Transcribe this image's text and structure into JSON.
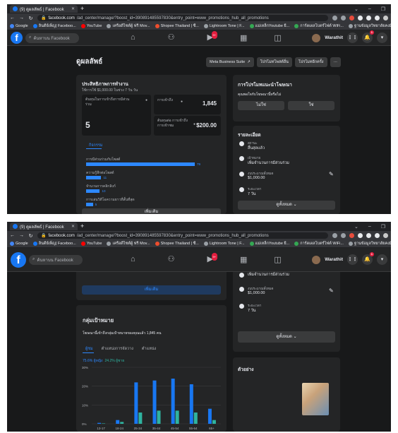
{
  "browser": {
    "tab_title": "(9) ดูผลลัพธ์ | Facebook",
    "new_tab": "+",
    "url1_host": "facebook.com",
    "url1_path": "/ad_center/manage/?boost_id=390891485597830&entry_point=www_promotions_hub_all_promotions",
    "url2_host": "facebook.com",
    "url2_path": "/ad_center/manage/?boost_id=390891485597830&entry_point=www_promotions_hub_all_promotions",
    "bookmarks": [
      "Google",
      "ลินดีย์เพ็ญ| Faceboo...",
      "YouTube",
      "เครือดีไซต์ผู้ ฟรี Mov...",
      "Shopee Thailand | ซื...",
      "Lightroom Tone | F...",
      "แม่เหล็กYoutube ยี...",
      "การ์ดเผลโบตร์ไฟต์ WiFi...",
      "ฐานข้อมูลวิทยาลัยคงมี..."
    ]
  },
  "fb": {
    "search_placeholder": "ค้นหาบน Facebook",
    "nav_badge": "9+",
    "user_name": "Warathit",
    "notif_badge": "1"
  },
  "page": {
    "title": "ดูผลลัพธ์",
    "buttons": [
      "Meta Business Suite",
      "โปรโมทโพสต์อื่น",
      "โปรโมทอีกครั้ง",
      "···"
    ]
  },
  "perf": {
    "title": "ประสิทธิภาพการทำงาน",
    "subtitle": "ใช้การใช้ $1,000.00 ในช่วง 7 วัน วัน",
    "m1_label": "ต้นทุนในการเข้าถึงการมีส่วนร่วม",
    "m1_value": "5",
    "m2_label": "การเข้าถึง",
    "m2_value": "1,845",
    "m3_label": "ต้นทุนต่อ การเข้าถึงการเข้าชม",
    "m3_value": "$200.00",
    "tab_label": "กิจกรรม",
    "bars": [
      {
        "label": "การมีส่วนร่วมกับโพสต์",
        "value": 79
      },
      {
        "label": "ความรู้สึกต่อโพสต์",
        "value": 11
      },
      {
        "label": "จำนวนการคลิกลิงก์",
        "value": 10
      },
      {
        "label": "การเล่นวิดีโอความยาวที่สั้นที่สุด",
        "value": 5
      }
    ],
    "see_more": "เพิ่มเติม"
  },
  "recommend": {
    "title": "การโปรโมทแนะนำโฆษณา",
    "question": "คุณพอใจกับโฆษณานี้หรือไม่",
    "no": "ไม่ใช่",
    "yes": "ใช่"
  },
  "details": {
    "title": "รายละเอียด",
    "rows": [
      {
        "key": "สถานะ",
        "value": "สิ้นสุดแล้ว"
      },
      {
        "key": "เป้าหมาย",
        "value": "เพิ่มจำนวนการมีส่วนร่วม"
      },
      {
        "key": "งบประมาณทั้งหมด",
        "value": "$1,000.00"
      },
      {
        "key": "ระยะเวลา",
        "value": "7 วัน"
      }
    ],
    "see_all": "ดูทั้งหมด"
  },
  "audience": {
    "title": "กลุ่มเป้าหมาย",
    "desc": "โฆษณานี้เข้าถึงกลุ่มเป้าหมายของคุณแล้ว 1,845 คน",
    "tabs": [
      "ผู้ชม",
      "ตำแหน่งการจัดวาง",
      "ตำแหน่ง"
    ],
    "legend_men": "75.6% ผู้หญิง",
    "legend_women": "24.2% ผู้ชาย"
  },
  "preview": {
    "title": "ตัวอย่าง"
  },
  "chart_data": {
    "type": "bar",
    "categories": [
      "13-17",
      "18-24",
      "25-34",
      "35-44",
      "45-54",
      "55-64",
      "65+"
    ],
    "ytick_labels": [
      "30%",
      "20%",
      "10%",
      "0%"
    ],
    "ylim": [
      0,
      30
    ],
    "series": [
      {
        "name": "ผู้หญิง",
        "color": "#1877f2",
        "values": [
          0.5,
          2,
          22,
          23,
          24,
          21,
          8
        ]
      },
      {
        "name": "ผู้ชาย",
        "color": "#2fb3a0",
        "values": [
          0.2,
          1,
          6,
          7,
          7,
          6,
          2
        ]
      }
    ]
  }
}
